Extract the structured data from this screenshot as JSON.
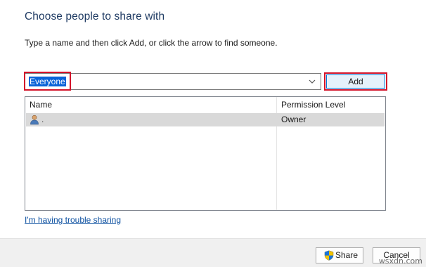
{
  "dialog": {
    "heading": "Choose people to share with",
    "instruction": "Type a name and then click Add, or click the arrow to find someone."
  },
  "picker": {
    "value": "Everyone",
    "add_label": "Add"
  },
  "table": {
    "columns": [
      "Name",
      "Permission Level"
    ],
    "rows": [
      {
        "name": ".",
        "permission": "Owner",
        "icon": "user-icon"
      }
    ]
  },
  "help_link": "I'm having trouble sharing",
  "footer": {
    "share_label": "Share",
    "cancel_label": "Cancel",
    "watermark": "wsxdn.com"
  },
  "colors": {
    "heading": "#1f3b63",
    "highlight": "#d3132a",
    "selection": "#0a64d8",
    "link": "#0b4fa0"
  }
}
